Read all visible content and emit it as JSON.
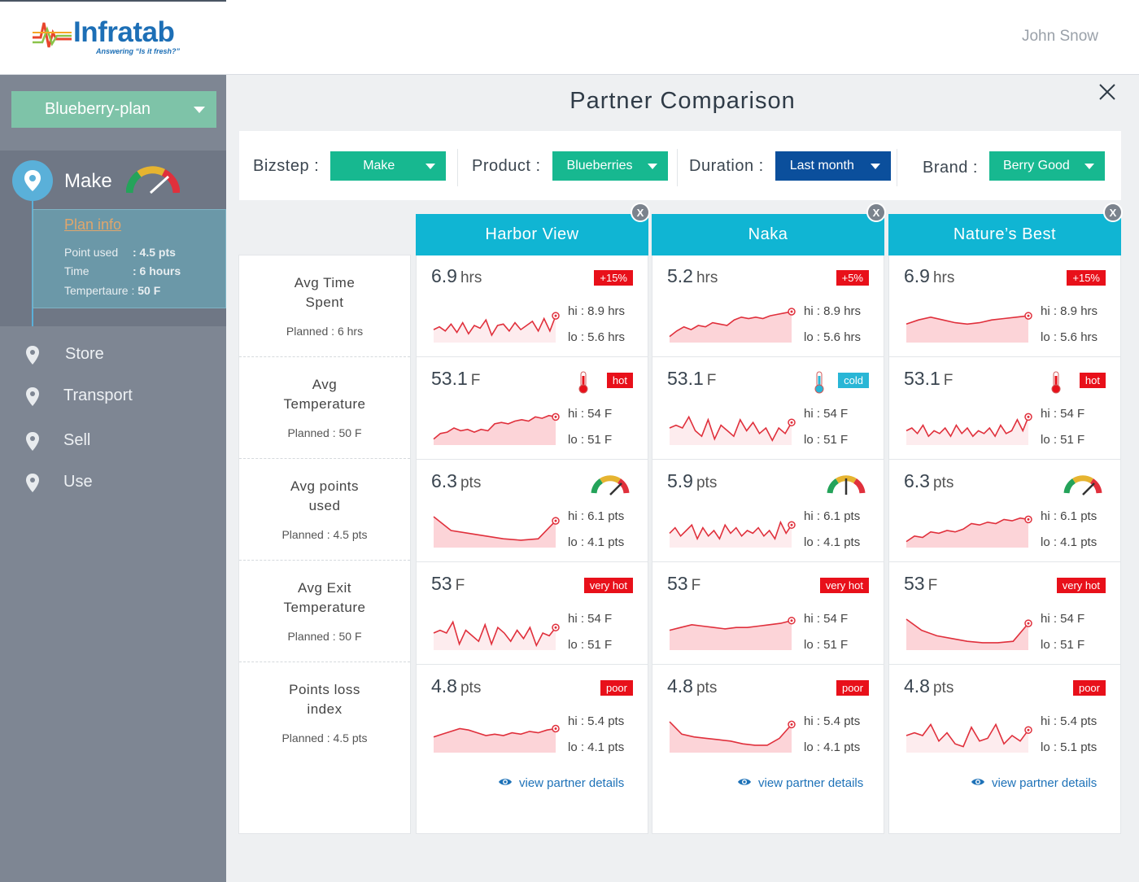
{
  "header": {
    "logo_text": "Infratab",
    "logo_tagline": "Answering “Is it fresh?”",
    "user_name": "John Snow"
  },
  "sidebar": {
    "plan_select": "Blueberry-plan",
    "active_step": {
      "label": "Make",
      "plan_info_link": "Plan info",
      "details": [
        {
          "key": "Point used",
          "value": ": 4.5 pts"
        },
        {
          "key": "Time",
          "value": ": 6 hours"
        },
        {
          "key": "Tempertaure :",
          "value": "50 F"
        }
      ]
    },
    "steps": [
      "Store",
      "Transport",
      "Sell",
      "Use"
    ]
  },
  "page": {
    "title": "Partner Comparison"
  },
  "filters": [
    {
      "label": "Bizstep :",
      "value": "Make",
      "color": "#17b890"
    },
    {
      "label": "Product :",
      "value": "Blueberries",
      "color": "#17b890"
    },
    {
      "label": "Duration :",
      "value": "Last month",
      "color": "#0b4f9c"
    },
    {
      "label": "Brand :",
      "value": "Berry Good",
      "color": "#17b890"
    }
  ],
  "metrics": [
    {
      "name_line1": "Avg Time",
      "name_line2": "Spent",
      "planned": "Planned :  6 hrs"
    },
    {
      "name_line1": "Avg",
      "name_line2": "Temperature",
      "planned": "Planned :  50 F"
    },
    {
      "name_line1": "Avg points",
      "name_line2": "used",
      "planned": "Planned :  4.5 pts"
    },
    {
      "name_line1": "Avg Exit",
      "name_line2": "Temperature",
      "planned": "Planned :  50 F"
    },
    {
      "name_line1": "Points loss",
      "name_line2": "index",
      "planned": "Planned :  4.5 pts"
    }
  ],
  "view_details_label": "view partner details",
  "remove_label": "X",
  "colors": {
    "accent": "#10b5d3",
    "alert": "#e8101a",
    "cold": "#29b6d6",
    "spark_line": "#e0303c",
    "spark_fill": "#fcd4d8"
  },
  "partners": [
    {
      "name": "Harbor View",
      "cells": [
        {
          "value": "6.9",
          "unit": "hrs",
          "badge": "+15%",
          "badge_type": "hot",
          "icon": "none",
          "hi": "hi : 8.9 hrs",
          "lo": "lo : 5.6 hrs",
          "spark": [
            0.35,
            0.45,
            0.3,
            0.55,
            0.25,
            0.6,
            0.2,
            0.5,
            0.4,
            0.7,
            0.15,
            0.5,
            0.55,
            0.3,
            0.6,
            0.35,
            0.5,
            0.65,
            0.3,
            0.75,
            0.3,
            0.85
          ],
          "spark_style": "line"
        },
        {
          "value": "53.1",
          "unit": "F",
          "badge": "hot",
          "badge_type": "hot",
          "icon": "thermometer-hot",
          "hi": "hi : 54 F",
          "lo": "lo : 51 F",
          "spark": [
            0.1,
            0.3,
            0.35,
            0.5,
            0.4,
            0.45,
            0.35,
            0.45,
            0.4,
            0.65,
            0.7,
            0.65,
            0.75,
            0.8,
            0.75,
            0.9,
            0.85,
            0.95,
            0.9
          ],
          "spark_style": "area"
        },
        {
          "value": "6.3",
          "unit": "pts",
          "badge": "",
          "badge_type": "none",
          "icon": "gauge",
          "hi": "hi : 6.1 pts",
          "lo": "lo : 4.1 pts",
          "spark": [
            1.0,
            0.5,
            0.4,
            0.3,
            0.2,
            0.15,
            0.2,
            0.85
          ],
          "spark_style": "area"
        },
        {
          "value": "53",
          "unit": "F",
          "badge": "very hot",
          "badge_type": "hot",
          "icon": "none",
          "hi": "hi : 54 F",
          "lo": "lo : 51 F",
          "spark": [
            0.5,
            0.6,
            0.5,
            0.9,
            0.1,
            0.6,
            0.4,
            0.2,
            0.8,
            0.1,
            0.7,
            0.5,
            0.2,
            0.6,
            0.3,
            0.7,
            0.05,
            0.5,
            0.4,
            0.7
          ],
          "spark_style": "line"
        },
        {
          "value": "4.8",
          "unit": "pts",
          "badge": "poor",
          "badge_type": "hot",
          "icon": "none",
          "hi": "hi : 5.4 pts",
          "lo": "lo : 4.1 pts",
          "spark": [
            0.45,
            0.55,
            0.65,
            0.75,
            0.7,
            0.6,
            0.5,
            0.55,
            0.5,
            0.6,
            0.55,
            0.65,
            0.6,
            0.7,
            0.75
          ],
          "spark_style": "area"
        }
      ]
    },
    {
      "name": "Naka",
      "cells": [
        {
          "value": "5.2",
          "unit": "hrs",
          "badge": "+5%",
          "badge_type": "hot",
          "icon": "none",
          "hi": "hi : 8.9 hrs",
          "lo": "lo : 5.6 hrs",
          "spark": [
            0.1,
            0.3,
            0.45,
            0.35,
            0.5,
            0.45,
            0.6,
            0.55,
            0.5,
            0.7,
            0.8,
            0.75,
            0.8,
            0.75,
            0.85,
            0.9,
            0.95,
            1.0
          ],
          "spark_style": "area"
        },
        {
          "value": "53.1",
          "unit": "F",
          "badge": "cold",
          "badge_type": "cold",
          "icon": "thermometer-cold",
          "hi": "hi : 54 F",
          "lo": "lo : 51 F",
          "spark": [
            0.5,
            0.6,
            0.5,
            0.9,
            0.4,
            0.2,
            0.8,
            0.1,
            0.6,
            0.4,
            0.2,
            0.8,
            0.4,
            0.7,
            0.3,
            0.5,
            0.05,
            0.5,
            0.3,
            0.7
          ],
          "spark_style": "line"
        },
        {
          "value": "5.9",
          "unit": "pts",
          "badge": "",
          "badge_type": "none",
          "icon": "gauge",
          "hi": "hi : 6.1 pts",
          "lo": "lo : 4.1 pts",
          "spark": [
            0.4,
            0.6,
            0.3,
            0.5,
            0.7,
            0.2,
            0.6,
            0.3,
            0.5,
            0.2,
            0.7,
            0.4,
            0.6,
            0.3,
            0.5,
            0.4,
            0.6,
            0.3,
            0.5,
            0.2,
            0.8,
            0.4,
            0.7
          ],
          "spark_style": "line"
        },
        {
          "value": "53",
          "unit": "F",
          "badge": "very hot",
          "badge_type": "hot",
          "icon": "none",
          "hi": "hi : 54 F",
          "lo": "lo : 51 F",
          "spark": [
            0.6,
            0.7,
            0.8,
            0.75,
            0.7,
            0.65,
            0.7,
            0.7,
            0.75,
            0.8,
            0.85,
            0.95
          ],
          "spark_style": "area"
        },
        {
          "value": "4.8",
          "unit": "pts",
          "badge": "poor",
          "badge_type": "hot",
          "icon": "none",
          "hi": "hi : 5.4 pts",
          "lo": "lo : 4.1 pts",
          "spark": [
            1.0,
            0.55,
            0.45,
            0.4,
            0.35,
            0.3,
            0.2,
            0.15,
            0.15,
            0.4,
            0.9
          ],
          "spark_style": "area"
        }
      ]
    },
    {
      "name": "Nature’s Best",
      "cells": [
        {
          "value": "6.9",
          "unit": "hrs",
          "badge": "+15%",
          "badge_type": "hot",
          "icon": "none",
          "hi": "hi : 8.9 hrs",
          "lo": "lo : 5.6 hrs",
          "spark": [
            0.55,
            0.7,
            0.8,
            0.7,
            0.6,
            0.55,
            0.6,
            0.7,
            0.75,
            0.8,
            0.85
          ],
          "spark_style": "area"
        },
        {
          "value": "53.1",
          "unit": "F",
          "badge": "hot",
          "badge_type": "hot",
          "icon": "thermometer-hot",
          "hi": "hi : 54 F",
          "lo": "lo : 51 F",
          "spark": [
            0.4,
            0.5,
            0.3,
            0.6,
            0.2,
            0.4,
            0.3,
            0.5,
            0.2,
            0.6,
            0.3,
            0.5,
            0.2,
            0.4,
            0.3,
            0.5,
            0.2,
            0.6,
            0.3,
            0.4,
            0.8,
            0.4,
            0.9
          ],
          "spark_style": "line"
        },
        {
          "value": "6.3",
          "unit": "pts",
          "badge": "",
          "badge_type": "none",
          "icon": "gauge",
          "hi": "hi : 6.1 pts",
          "lo": "lo : 4.1 pts",
          "spark": [
            0.1,
            0.3,
            0.25,
            0.45,
            0.4,
            0.5,
            0.45,
            0.55,
            0.75,
            0.7,
            0.8,
            0.75,
            0.9,
            0.85,
            0.95,
            0.9
          ],
          "spark_style": "area"
        },
        {
          "value": "53",
          "unit": "F",
          "badge": "very hot",
          "badge_type": "hot",
          "icon": "none",
          "hi": "hi : 54 F",
          "lo": "lo : 51 F",
          "spark": [
            1.0,
            0.6,
            0.4,
            0.3,
            0.2,
            0.15,
            0.15,
            0.2,
            0.85
          ],
          "spark_style": "area"
        },
        {
          "value": "4.8",
          "unit": "pts",
          "badge": "poor",
          "badge_type": "hot",
          "icon": "none",
          "hi": "hi : 5.4 pts",
          "lo": "lo : 5.1 pts",
          "spark": [
            0.5,
            0.6,
            0.5,
            0.9,
            0.3,
            0.6,
            0.2,
            0.1,
            0.8,
            0.3,
            0.4,
            0.9,
            0.2,
            0.5,
            0.3,
            0.7
          ],
          "spark_style": "line"
        }
      ]
    }
  ]
}
